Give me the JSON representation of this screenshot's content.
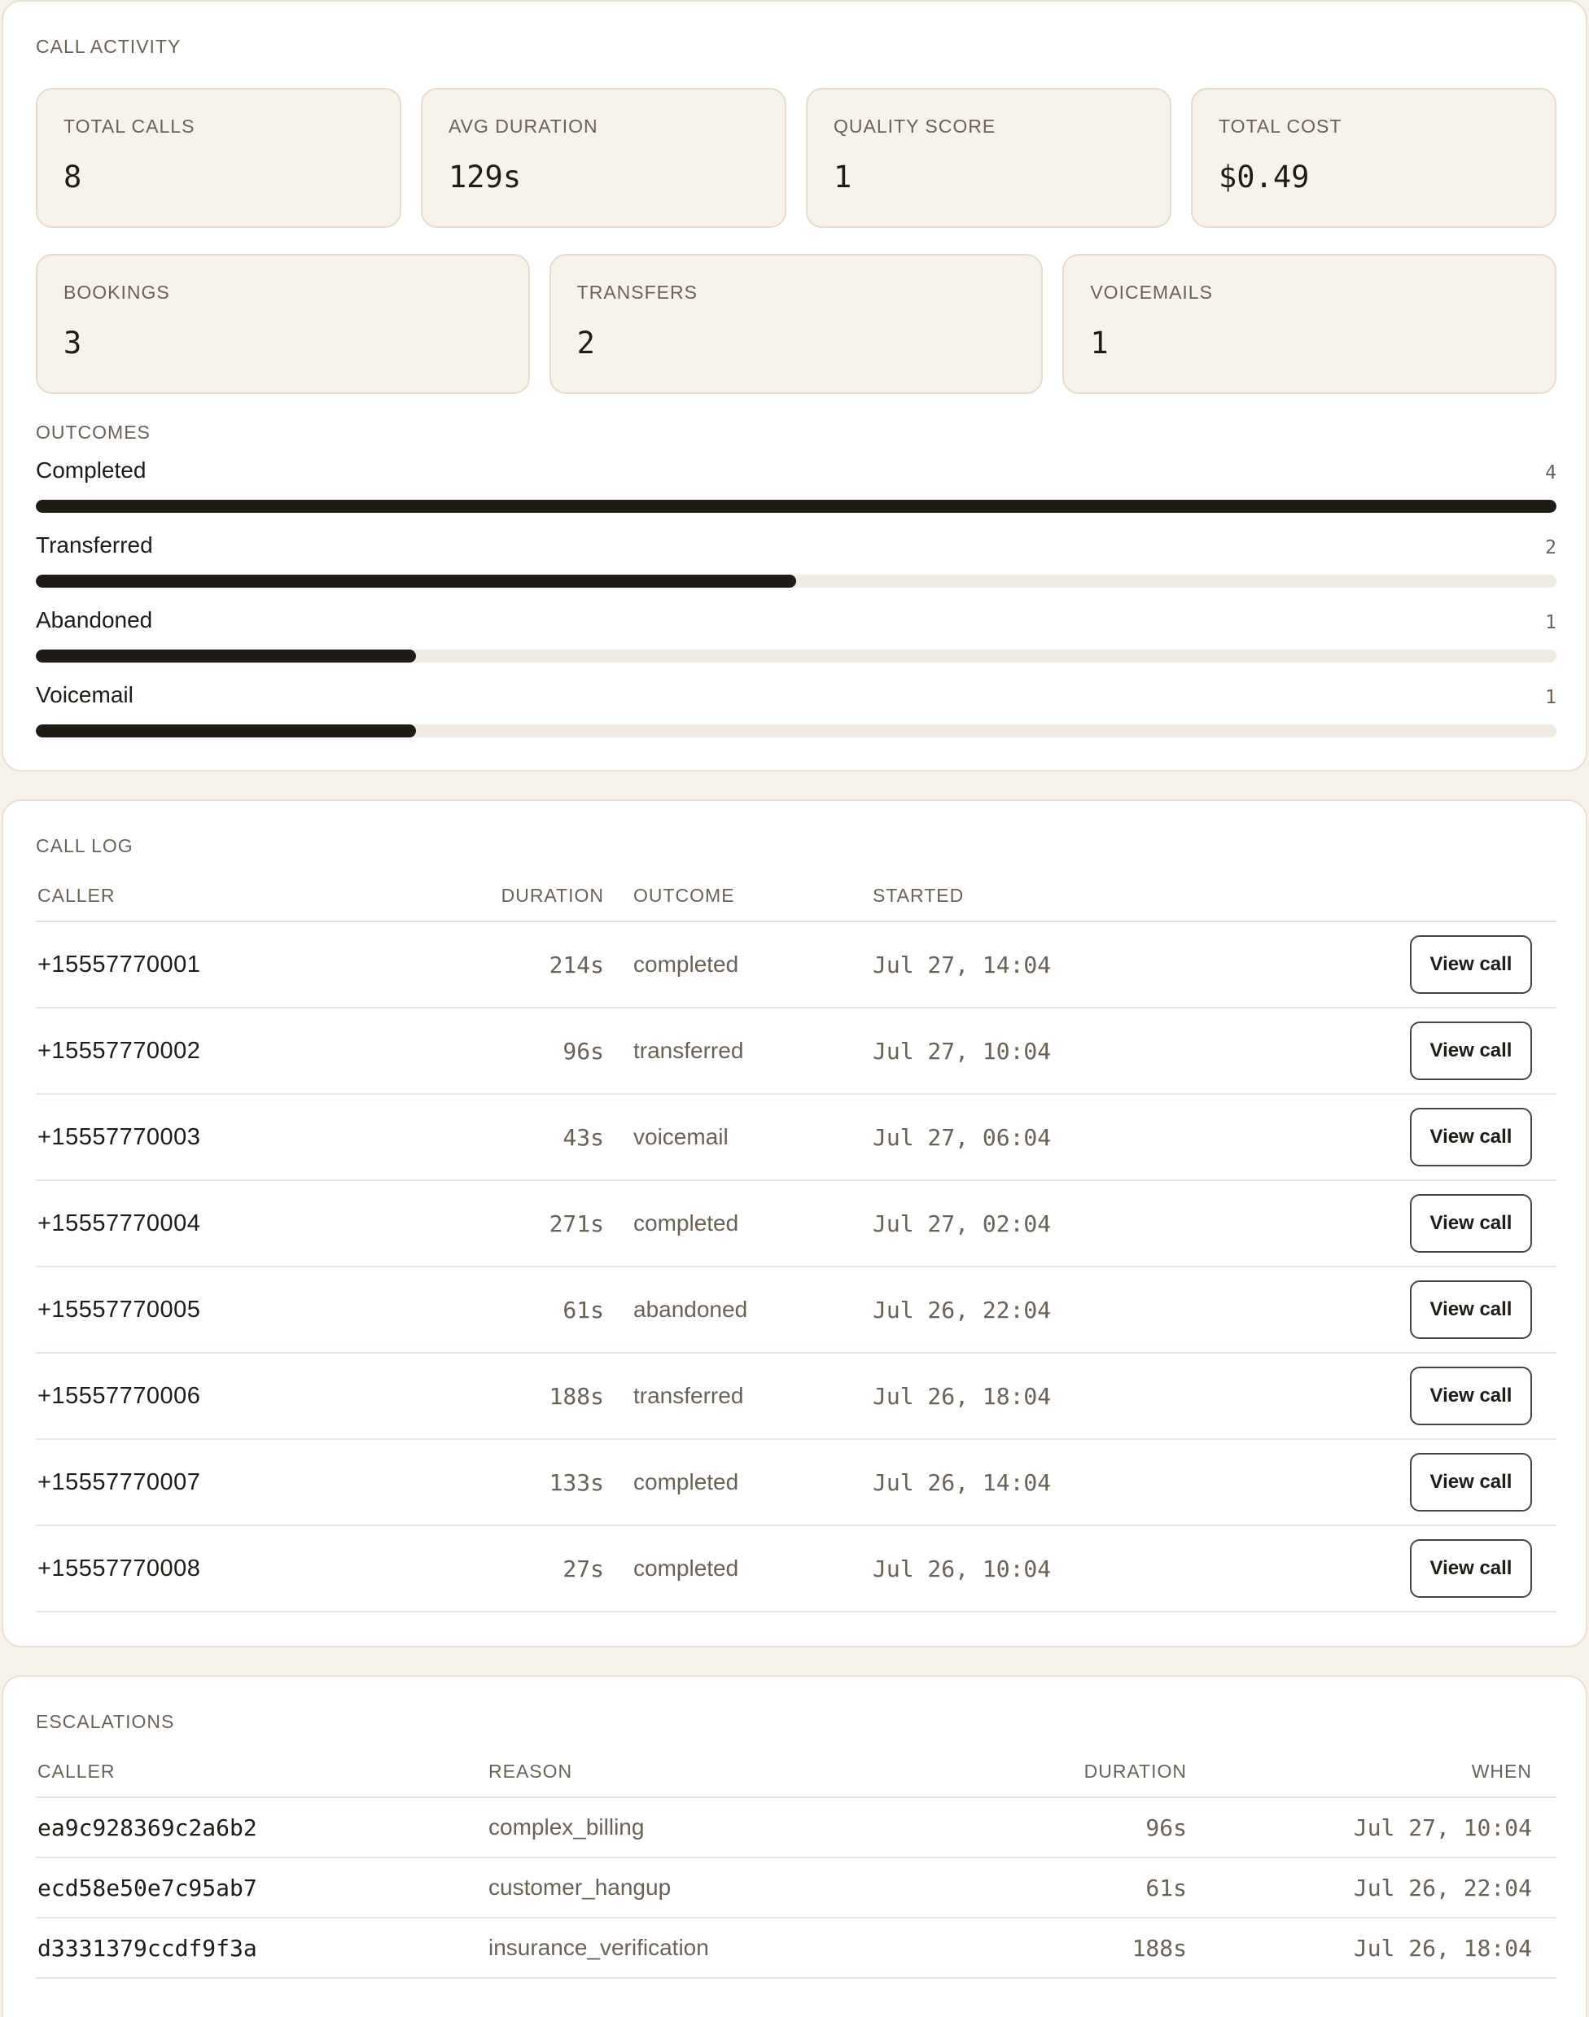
{
  "call_activity": {
    "title": "CALL ACTIVITY",
    "stats_row1": [
      {
        "label": "TOTAL CALLS",
        "value": "8"
      },
      {
        "label": "AVG DURATION",
        "value": "129s"
      },
      {
        "label": "QUALITY SCORE",
        "value": "1"
      },
      {
        "label": "TOTAL COST",
        "value": "$0.49"
      }
    ],
    "stats_row2": [
      {
        "label": "BOOKINGS",
        "value": "3"
      },
      {
        "label": "TRANSFERS",
        "value": "2"
      },
      {
        "label": "VOICEMAILS",
        "value": "1"
      }
    ],
    "outcomes_title": "OUTCOMES",
    "outcomes": [
      {
        "label": "Completed",
        "count": "4",
        "fraction": 1.0
      },
      {
        "label": "Transferred",
        "count": "2",
        "fraction": 0.5
      },
      {
        "label": "Abandoned",
        "count": "1",
        "fraction": 0.25
      },
      {
        "label": "Voicemail",
        "count": "1",
        "fraction": 0.25
      }
    ],
    "bar_color": "#1f1b16",
    "track_color": "#f0ebe2"
  },
  "call_log": {
    "title": "CALL LOG",
    "columns": {
      "caller": "CALLER",
      "duration": "DURATION",
      "outcome": "OUTCOME",
      "started": "STARTED"
    },
    "action_label": "View call",
    "rows": [
      {
        "caller": "+15557770001",
        "duration": "214s",
        "outcome": "completed",
        "started": "Jul 27, 14:04"
      },
      {
        "caller": "+15557770002",
        "duration": "96s",
        "outcome": "transferred",
        "started": "Jul 27, 10:04"
      },
      {
        "caller": "+15557770003",
        "duration": "43s",
        "outcome": "voicemail",
        "started": "Jul 27, 06:04"
      },
      {
        "caller": "+15557770004",
        "duration": "271s",
        "outcome": "completed",
        "started": "Jul 27, 02:04"
      },
      {
        "caller": "+15557770005",
        "duration": "61s",
        "outcome": "abandoned",
        "started": "Jul 26, 22:04"
      },
      {
        "caller": "+15557770006",
        "duration": "188s",
        "outcome": "transferred",
        "started": "Jul 26, 18:04"
      },
      {
        "caller": "+15557770007",
        "duration": "133s",
        "outcome": "completed",
        "started": "Jul 26, 14:04"
      },
      {
        "caller": "+15557770008",
        "duration": "27s",
        "outcome": "completed",
        "started": "Jul 26, 10:04"
      }
    ]
  },
  "escalations": {
    "title": "ESCALATIONS",
    "columns": {
      "caller": "CALLER",
      "reason": "REASON",
      "duration": "DURATION",
      "when": "WHEN"
    },
    "rows": [
      {
        "caller": "ea9c928369c2a6b2",
        "reason": "complex_billing",
        "duration": "96s",
        "when": "Jul 27, 10:04"
      },
      {
        "caller": "ecd58e50e7c95ab7",
        "reason": "customer_hangup",
        "duration": "61s",
        "when": "Jul 26, 22:04"
      },
      {
        "caller": "d3331379ccdf9f3a",
        "reason": "insurance_verification",
        "duration": "188s",
        "when": "Jul 26, 18:04"
      }
    ]
  }
}
